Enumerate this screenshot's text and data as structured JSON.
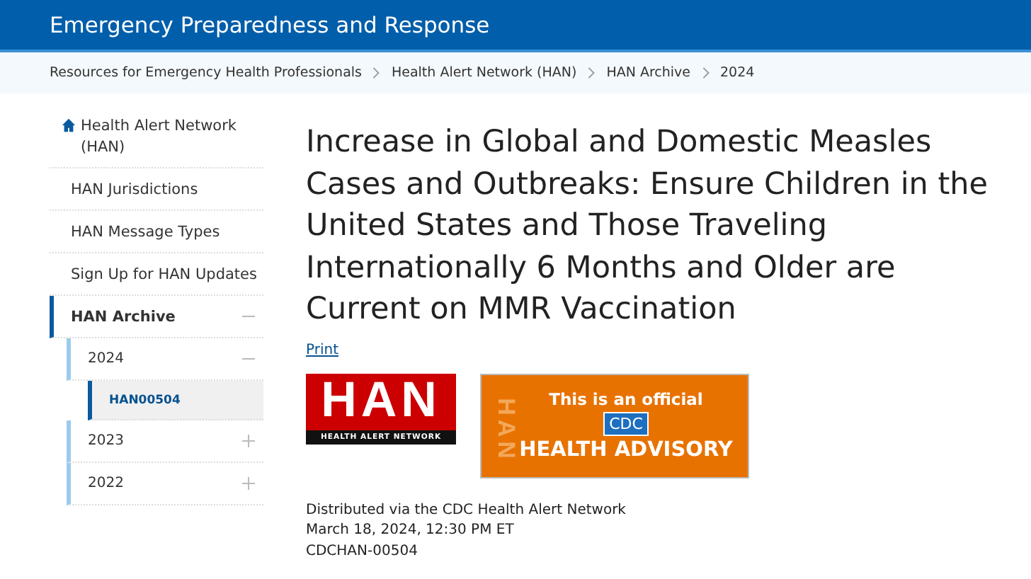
{
  "header": {
    "title": "Emergency Preparedness and Response"
  },
  "breadcrumbs": [
    "Resources for Emergency Health Professionals",
    "Health Alert Network (HAN)",
    "HAN Archive",
    "2024"
  ],
  "sidebar": {
    "home": "Health Alert Network (HAN)",
    "items": [
      {
        "label": "HAN Jurisdictions",
        "selected": false
      },
      {
        "label": "HAN Message Types",
        "selected": false
      },
      {
        "label": "Sign Up for HAN Updates",
        "selected": false
      },
      {
        "label": "HAN Archive",
        "selected": true,
        "expanded": true,
        "children": [
          {
            "label": "2024",
            "selected": false,
            "expanded": true,
            "children": [
              {
                "label": "HAN00504",
                "selected": true
              }
            ]
          },
          {
            "label": "2023",
            "selected": false,
            "expanded": false
          },
          {
            "label": "2022",
            "selected": false,
            "expanded": false
          }
        ]
      }
    ]
  },
  "article": {
    "title": "Increase in Global and Domestic Measles Cases and Outbreaks: Ensure Children in the United States and Those Traveling Internationally 6 Months and Older are Current on MMR Vaccination",
    "print_link": "Print",
    "han_logo": {
      "letters": "HAN",
      "caption": "HEALTH ALERT NETWORK"
    },
    "advisory_banner": {
      "side_mark": "HAN",
      "line_1": "This is an official",
      "agency": "CDC",
      "line_2": "HEALTH ADVISORY"
    },
    "meta": [
      "Distributed via the CDC Health Alert Network",
      "March 18, 2024, 12:30 PM ET",
      "CDCHAN-00504"
    ]
  }
}
